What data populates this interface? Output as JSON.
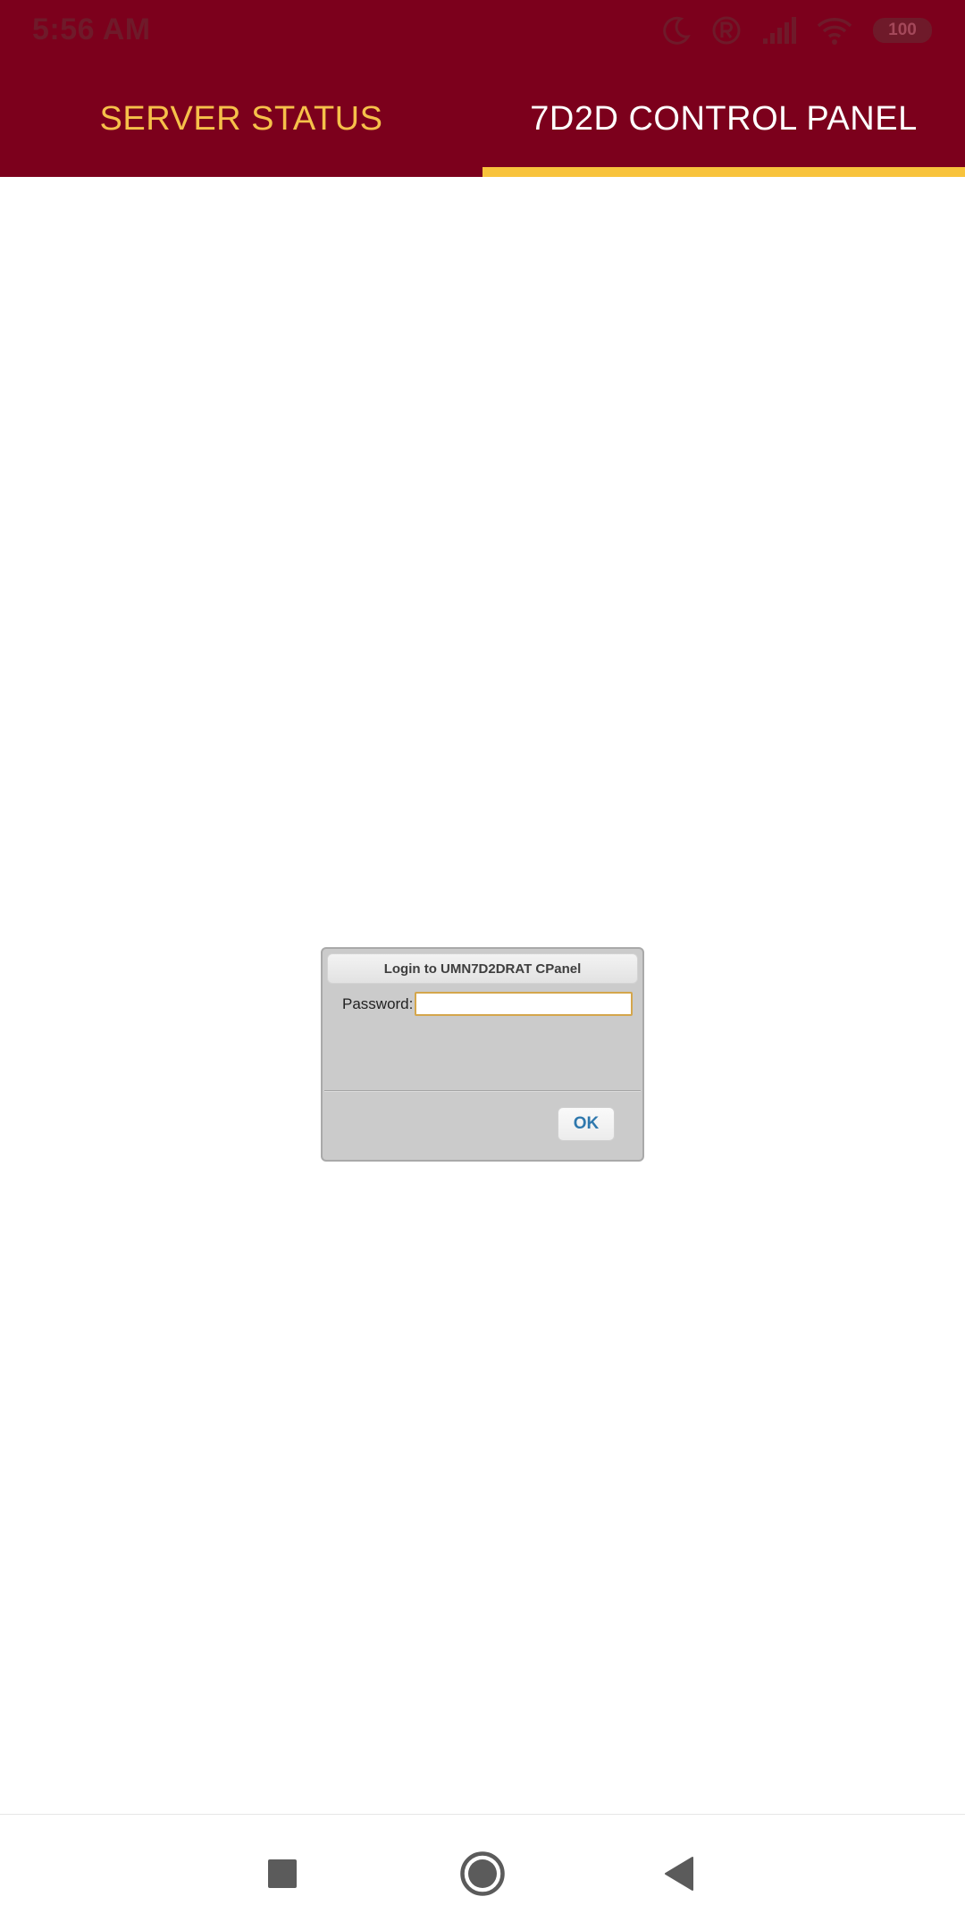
{
  "status_bar": {
    "time": "5:56 AM",
    "battery": "100",
    "icons": [
      "moon-icon",
      "registered-icon",
      "signal-icon",
      "wifi-icon",
      "battery-icon"
    ]
  },
  "tabs": [
    {
      "label": "SERVER STATUS",
      "selected": false
    },
    {
      "label": "7D2D CONTROL PANEL",
      "selected": true
    }
  ],
  "dialog": {
    "title": "Login to UMN7D2DRAT CPanel",
    "password_label": "Password:",
    "password_value": "",
    "ok_label": "OK"
  },
  "navbar": {
    "icons": [
      "recents-square-icon",
      "home-circle-icon",
      "back-triangle-icon"
    ]
  },
  "colors": {
    "header_bg": "#7c001c",
    "tab_inactive_text": "#f6c04a",
    "tab_active_text": "#ffffff",
    "tab_indicator": "#f8c33c",
    "dialog_bg": "#cbcbcb",
    "ok_text": "#2f78ad"
  }
}
